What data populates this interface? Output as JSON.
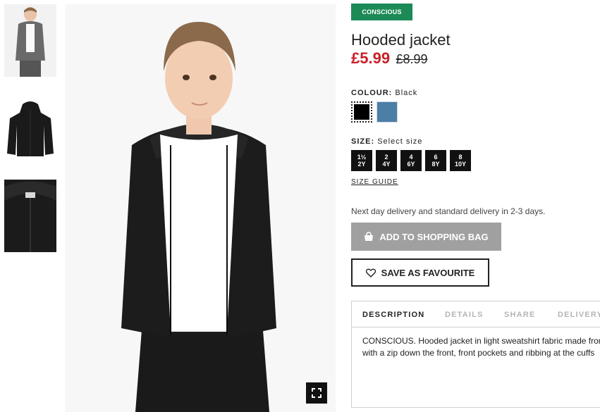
{
  "gallery": {
    "thumbnails": [
      {
        "icon": "child-in-grey-hoodie-photo"
      },
      {
        "icon": "black-hooded-jacket-photo"
      },
      {
        "icon": "jacket-closeup-photo"
      }
    ],
    "main_image": {
      "icon": "child-wearing-black-hooded-jacket-photo"
    },
    "fullscreen_icon": "expand-icon"
  },
  "product": {
    "badge": "CONSCIOUS",
    "title": "Hooded jacket",
    "price_sale": "£5.99",
    "price_old": "£8.99",
    "colour_label": "COLOUR:",
    "colour_value": "Black",
    "colours": [
      {
        "name": "Black",
        "hex": "#000000"
      },
      {
        "name": "Blue",
        "hex": "#4c7fa6"
      }
    ],
    "size_label": "SIZE:",
    "size_value": "Select size",
    "sizes": [
      {
        "top": "1½",
        "bottom": "2Y"
      },
      {
        "top": "2",
        "bottom": "4Y"
      },
      {
        "top": "4",
        "bottom": "6Y"
      },
      {
        "top": "6",
        "bottom": "8Y"
      },
      {
        "top": "8",
        "bottom": "10Y"
      }
    ],
    "size_guide": "SIZE GUIDE",
    "delivery_note": "Next day delivery and standard delivery in 2-3 days.",
    "add_to_bag": "ADD TO SHOPPING BAG",
    "save_favourite": "SAVE AS FAVOURITE"
  },
  "info_tabs": {
    "tabs": [
      "DESCRIPTION",
      "DETAILS",
      "SHARE",
      "DELIVERY"
    ],
    "active": "DESCRIPTION",
    "description_lines": [
      "CONSCIOUS. Hooded jacket in light sweatshirt fabric made from",
      "with a zip down the front, front pockets and ribbing at the cuffs"
    ]
  },
  "colors": {
    "badge": "#1c8a57",
    "sale_price": "#c8202a",
    "add_button": "#a0a0a0"
  }
}
